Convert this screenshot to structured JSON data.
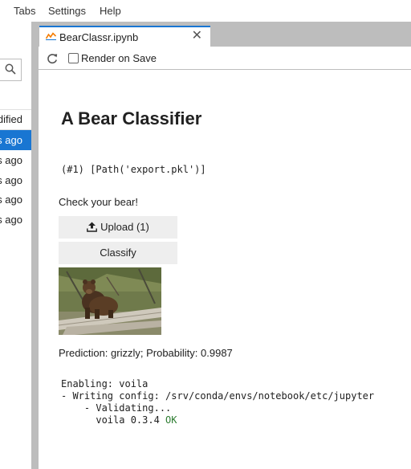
{
  "menubar": {
    "items": [
      "Tabs",
      "Settings",
      "Help"
    ]
  },
  "sidebar": {
    "header_label": "Last Modified",
    "rows": [
      {
        "text": "seconds ago",
        "selected": true
      },
      {
        "text": "minutes ago",
        "selected": false
      },
      {
        "text": "minutes ago",
        "selected": false
      },
      {
        "text": "minutes ago",
        "selected": false
      },
      {
        "text": "minutes ago",
        "selected": false
      }
    ]
  },
  "tab": {
    "title": "BearClassr.ipynb",
    "close": "✕"
  },
  "toolbar": {
    "render_on_save_label": "Render on Save",
    "render_on_save_checked": false
  },
  "notebook": {
    "title": "A Bear Classifier",
    "output_path": "(#1) [Path('export.pkl')]",
    "check_text": "Check your bear!",
    "upload_label": "Upload (1)",
    "classify_label": "Classify",
    "prediction": "Prediction: grizzly; Probability: 0.9987",
    "log_lines": [
      "Enabling: voila",
      "- Writing config: /srv/conda/envs/notebook/etc/jupyter",
      "    - Validating..."
    ],
    "log_last_prefix": "      voila 0.3.4 ",
    "log_ok": "OK"
  },
  "colors": {
    "accent": "#1976d2",
    "panel_gray": "#bdbdbd",
    "button_gray": "#eeeeee",
    "ok_green": "#2e7d32"
  }
}
